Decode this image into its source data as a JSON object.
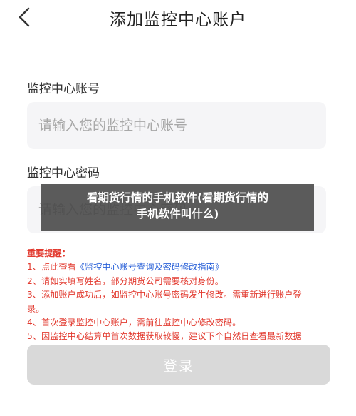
{
  "header": {
    "back_icon": "chevron-left-icon",
    "title": "添加监控中心账户"
  },
  "form": {
    "account": {
      "label": "监控中心账号",
      "placeholder": "请输入您的监控中心账号"
    },
    "password": {
      "label": "监控中心密码",
      "placeholder": "请输入您的监控中心密码"
    }
  },
  "notice": {
    "title": "重要提醒：",
    "line1_prefix": "1、点此查看",
    "line1_link": "《监控中心账号查询及密码修改指南》",
    "line2": "2、请如实填写姓名，部分期货公司需要核对身份。",
    "line3a": "3、添加账户成功后，如监控中心账号密码发生修改。需重新进行账户登",
    "line3b": "录。",
    "line4": "4、首次登录监控中心账户，需前往监控中心修改密码。",
    "line5": "5、因监控中心结算单首次数据获取较慢，建议下个自然日查看最新数据"
  },
  "login_button": {
    "label": "登录"
  },
  "overlay": {
    "line1": "看期货行情的手机软件(看期货行情的",
    "line2": "手机软件叫什么)"
  },
  "colors": {
    "notice_red": "#e23a2f",
    "link_blue": "#2b62d8",
    "button_disabled": "#d9d9d9",
    "input_bg": "#f5f5f7"
  }
}
